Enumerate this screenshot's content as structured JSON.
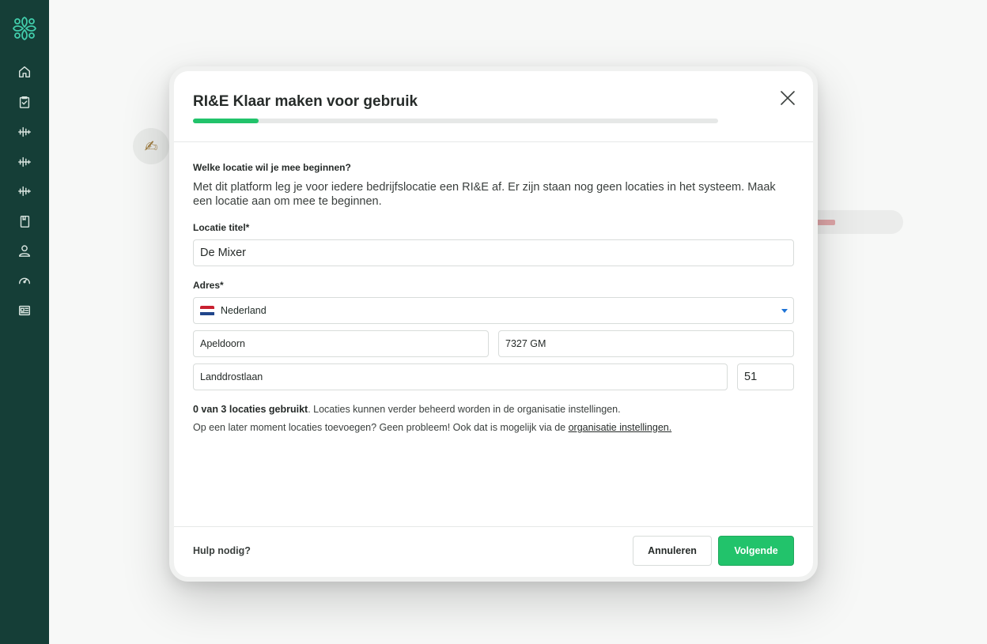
{
  "sidebar": {
    "logo_icon": "flower-logo-icon",
    "items": [
      {
        "icon": "home-icon"
      },
      {
        "icon": "clipboard-check-icon"
      },
      {
        "icon": "waveform-icon"
      },
      {
        "icon": "waveform-icon"
      },
      {
        "icon": "waveform-icon"
      },
      {
        "icon": "book-icon"
      },
      {
        "icon": "user-icon"
      },
      {
        "icon": "speedometer-icon"
      },
      {
        "icon": "newspaper-icon"
      }
    ]
  },
  "modal": {
    "title": "RI&E Klaar maken voor gebruik",
    "progress": 0.125,
    "question": "Welke locatie wil je mee beginnen?",
    "intro": "Met dit platform leg je voor iedere bedrijfslocatie een RI&E af. Er zijn staan nog geen locaties in het systeem. Maak een locatie aan om mee te beginnen.",
    "location_title_label": "Locatie titel*",
    "location_title_value": "De Mixer",
    "address_label": "Adres*",
    "country": "Nederland",
    "city": "Apeldoorn",
    "postal_code": "7327 GM",
    "street": "Landdrostlaan",
    "house_number": "51",
    "usage_bold": "0 van 3 locaties gebruikt",
    "usage_rest": ". Locaties kunnen verder beheerd worden in de organisatie instellingen.",
    "later_text": "Op een later moment locaties toevoegen? Geen probleem! Ook dat is mogelijk via de ",
    "later_link": "organisatie instellingen.",
    "help": "Hulp nodig?",
    "cancel": "Annuleren",
    "next": "Volgende"
  },
  "colors": {
    "sidebar": "#0f3a33",
    "accent": "#22c36b"
  }
}
